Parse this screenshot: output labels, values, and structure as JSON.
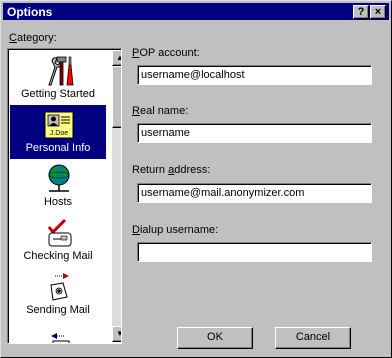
{
  "window": {
    "title": "Options",
    "help_label": "?",
    "close_label": "×"
  },
  "category": {
    "label": "Category:",
    "items": [
      {
        "label": "Getting Started",
        "icon": "tools-icon",
        "selected": false
      },
      {
        "label": "Personal Info",
        "icon": "id-card-icon",
        "selected": true
      },
      {
        "label": "Hosts",
        "icon": "globe-network-icon",
        "selected": false
      },
      {
        "label": "Checking Mail",
        "icon": "check-mail-icon",
        "selected": false
      },
      {
        "label": "Sending Mail",
        "icon": "send-mail-icon",
        "selected": false
      }
    ],
    "id_card_text": "J.Doe"
  },
  "fields": {
    "pop_account": {
      "label": "POP account:",
      "value": "username@localhost"
    },
    "real_name": {
      "label": "Real name:",
      "value": "username"
    },
    "return_address": {
      "label": "Return address:",
      "value": "username@mail.anonymizer.com"
    },
    "dialup_username": {
      "label": "Dialup username:",
      "value": ""
    }
  },
  "buttons": {
    "ok": "OK",
    "cancel": "Cancel"
  },
  "colors": {
    "titlebar": "#000080",
    "selection": "#000080",
    "face": "#c0c0c0"
  }
}
